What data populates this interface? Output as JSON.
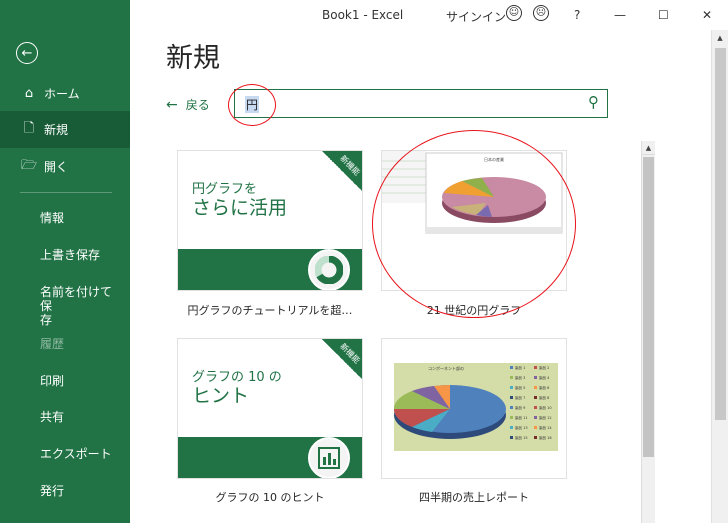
{
  "titlebar": {
    "doc_title": "Book1  -  Excel",
    "signin": "サインイン",
    "help": "?",
    "minimize": "—",
    "maximize": "☐",
    "close": "✕"
  },
  "sidebar": {
    "back_icon": "back-arrow-icon",
    "items": [
      {
        "label": "ホーム",
        "icon": "home-icon"
      },
      {
        "label": "新規",
        "icon": "new-document-icon"
      },
      {
        "label": "開く",
        "icon": "open-folder-icon"
      }
    ],
    "sub_items": [
      "情報",
      "上書き保存",
      "名前を付けて保\n存",
      "履歴",
      "印刷",
      "共有",
      "エクスポート",
      "発行"
    ]
  },
  "main": {
    "page_title": "新規",
    "back_label": "戻る",
    "search": {
      "value": "円"
    }
  },
  "cards": [
    {
      "line1": "円グラフを",
      "line2": "さらに活用",
      "ribbon": "新機能",
      "caption": "円グラフのチュートリアルを超…"
    },
    {
      "caption": "21 世紀の円グラフ",
      "thumb_title": "日本の産業"
    },
    {
      "line1": "グラフの 10 の",
      "line2": "ヒント",
      "ribbon": "新機能",
      "caption": "グラフの 10 のヒント"
    },
    {
      "caption": "四半期の売上レポート",
      "thumb_title": "コンポーネント部の",
      "legend": [
        "製品 1",
        "製品 2",
        "製品 3",
        "製品 4",
        "製品 5",
        "製品 6",
        "製品 7",
        "製品 8",
        "製品 9",
        "製品 10",
        "製品 11",
        "製品 12",
        "製品 13",
        "製品 14",
        "製品 15",
        "製品 16"
      ]
    }
  ],
  "colors": {
    "accent": "#217346",
    "accent_dark": "#185c37",
    "annotation": "#e8141b"
  }
}
